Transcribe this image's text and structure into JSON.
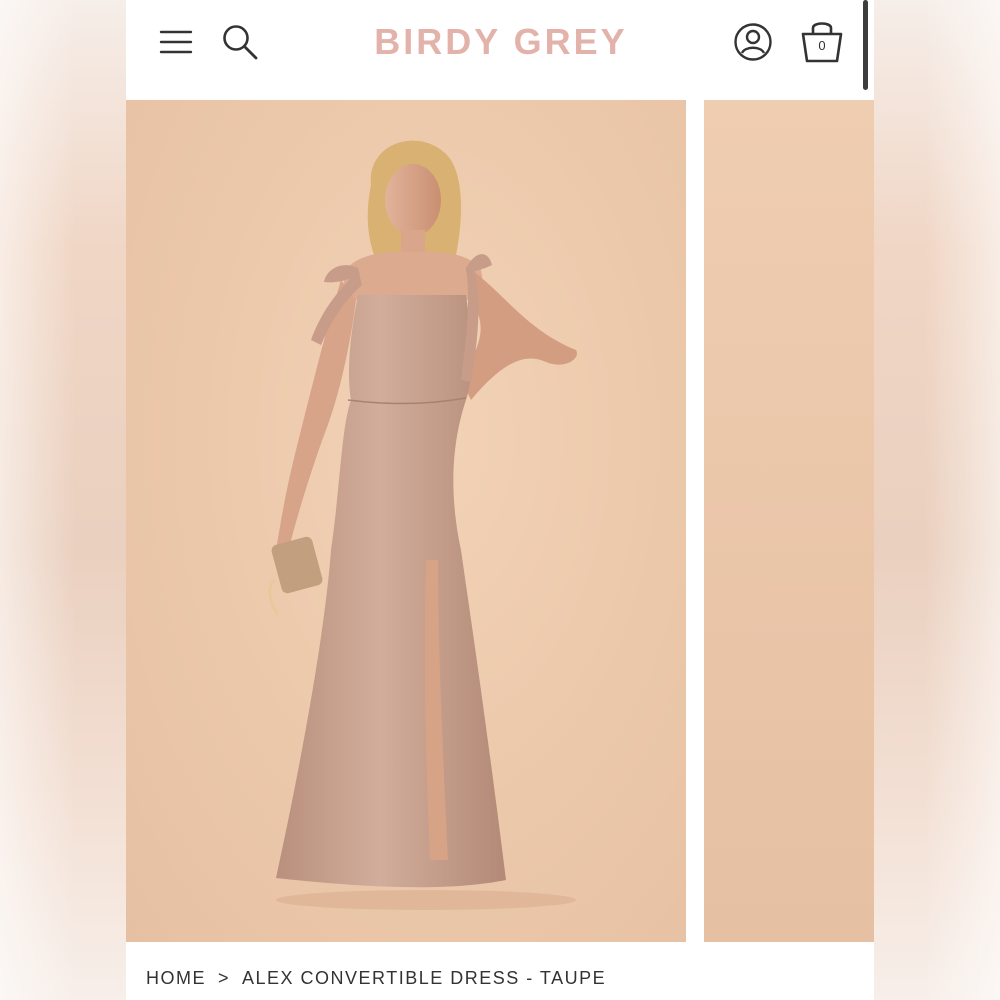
{
  "header": {
    "logo": "BIRDY GREY",
    "cart_count": "0"
  },
  "icons": {
    "menu": "hamburger-menu-icon",
    "search": "search-icon",
    "account": "account-icon",
    "cart": "shopping-bag-icon"
  },
  "colors": {
    "brand": "#e2b2ab",
    "backdrop": "#ecc8aa",
    "dress": "#c9a18e"
  },
  "gallery": {
    "current_image": "model wearing taupe convertible dress"
  },
  "breadcrumb": {
    "home": "HOME",
    "separator": ">",
    "current": "ALEX CONVERTIBLE DRESS - TAUPE"
  }
}
